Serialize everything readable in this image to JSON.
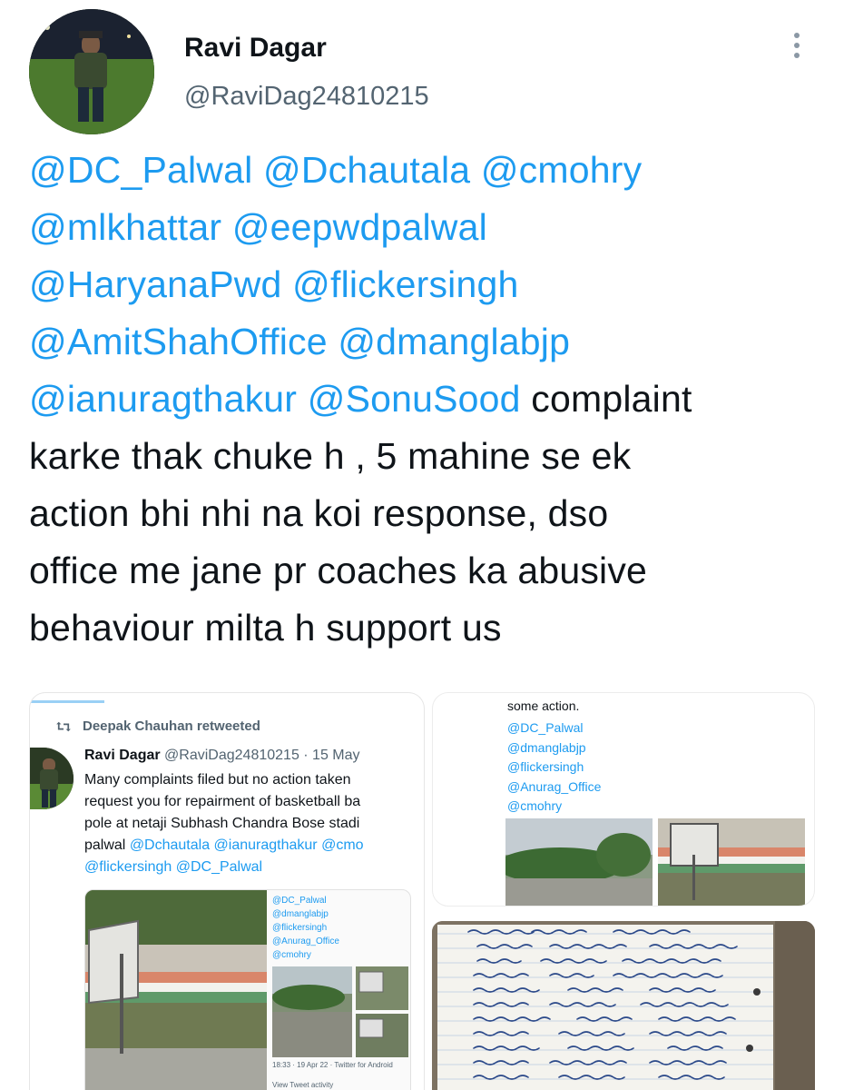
{
  "author": {
    "display_name": "Ravi Dagar",
    "handle": "@RaviDag24810215"
  },
  "tweet": {
    "mentions_line1": [
      "@DC_Palwal",
      "@Dchautala",
      "@cmohry"
    ],
    "mentions_line2": [
      "@mlkhattar",
      "@eepwdpalwal"
    ],
    "mentions_line3": [
      "@HaryanaPwd",
      "@flickersingh"
    ],
    "mentions_line4": [
      "@AmitShahOffice",
      "@dmanglabjp"
    ],
    "mentions_line5": [
      "@ianuragthakur",
      "@SonuSood"
    ],
    "text_line5": "complaint",
    "text_line6": "karke thak chuke h , 5 mahine se ek",
    "text_line7": "action bhi nhi na koi response, dso",
    "text_line8": "office me jane pr coaches ka abusive",
    "text_line9": "behaviour milta h support us"
  },
  "media_1": {
    "retweet_label": "Deepak Chauhan retweeted",
    "name": "Ravi Dagar",
    "handle_date": "@RaviDag24810215 · 15 May",
    "lines": [
      "Many complaints filed but no action taken",
      "request you for repairment of basketball ba",
      "pole at netaji Subhash Chandra Bose stadi"
    ],
    "line4_text": "palwal",
    "line4_mentions": "@Dchautala @ianuragthakur @cmo",
    "line5_mentions": "@flickersingh @DC_Palwal",
    "card_mentions": [
      "@DC_Palwal",
      "@dmanglabjp",
      "@flickersingh",
      "@Anurag_Office",
      "@cmohry"
    ],
    "card_meta": "18:33 · 19 Apr 22 · Twitter for Android",
    "card_activity": "View Tweet activity"
  },
  "media_2": {
    "text": "some action.",
    "mentions": [
      "@DC_Palwal",
      "@dmanglabjp",
      "@flickersingh",
      "@Anurag_Office",
      "@cmohry"
    ]
  },
  "colors": {
    "link": "#1d9bf0",
    "secondary": "#536471",
    "text": "#0f1419"
  },
  "icons": {
    "more": "more-vertical-icon",
    "retweet": "retweet-icon"
  }
}
